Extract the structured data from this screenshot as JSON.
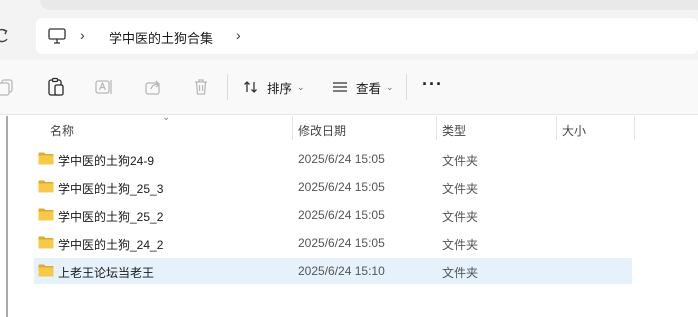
{
  "address": {
    "breadcrumb": "学中医的土狗合集",
    "pc_icon": "monitor-icon",
    "separator": "›"
  },
  "toolbar": {
    "sort_label": "排序",
    "view_label": "查看",
    "more_label": "···"
  },
  "columns": {
    "name": "名称",
    "modified": "修改日期",
    "type": "类型",
    "size": "大小"
  },
  "files": [
    {
      "name": "学中医的土狗24-9",
      "modified": "2025/6/24 15:05",
      "type": "文件夹",
      "selected": false
    },
    {
      "name": "学中医的土狗_25_3",
      "modified": "2025/6/24 15:05",
      "type": "文件夹",
      "selected": false
    },
    {
      "name": "学中医的土狗_25_2",
      "modified": "2025/6/24 15:05",
      "type": "文件夹",
      "selected": false
    },
    {
      "name": "学中医的土狗_24_2",
      "modified": "2025/6/24 15:05",
      "type": "文件夹",
      "selected": false
    },
    {
      "name": "上老王论坛当老王",
      "modified": "2025/6/24 15:10",
      "type": "文件夹",
      "selected": true
    }
  ],
  "colors": {
    "folder": "#f7c948",
    "folder_dark": "#e0a92a",
    "selection": "#e5f1fb",
    "accent": "#0067c0"
  }
}
